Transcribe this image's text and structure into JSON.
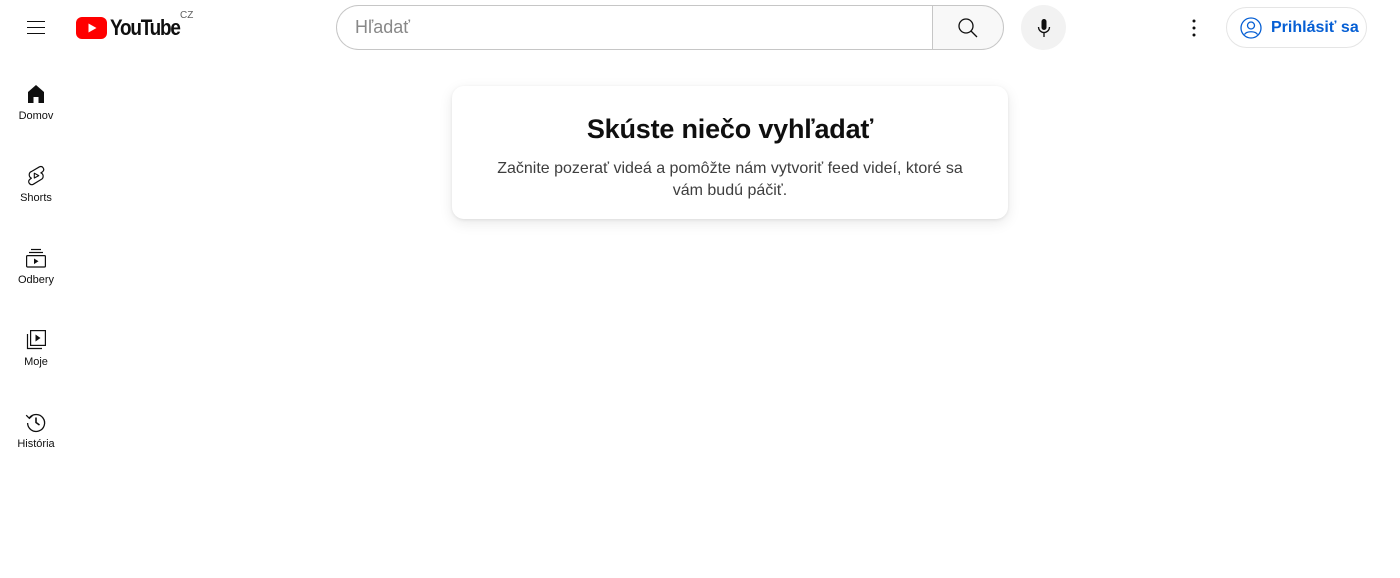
{
  "header": {
    "logo_text": "YouTube",
    "country_code": "CZ",
    "search_placeholder": "Hľadať",
    "signin_label": "Prihlásiť sa",
    "accent_color": "#065fd4",
    "logo_red": "#ff0000"
  },
  "sidebar": {
    "items": [
      {
        "label": "Domov",
        "icon": "home-icon"
      },
      {
        "label": "Shorts",
        "icon": "shorts-icon"
      },
      {
        "label": "Odbery",
        "icon": "subscriptions-icon"
      },
      {
        "label": "Moje",
        "icon": "library-icon"
      },
      {
        "label": "História",
        "icon": "history-icon"
      }
    ]
  },
  "main": {
    "prompt_title": "Skúste niečo vyhľadať",
    "prompt_body": "Začnite pozerať videá a pomôžte nám vytvoriť feed videí, ktoré sa vám budú páčiť."
  }
}
